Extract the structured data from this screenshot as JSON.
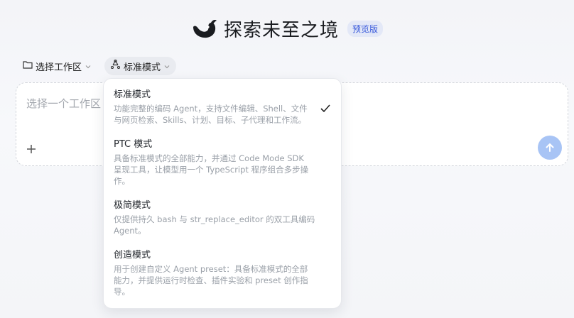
{
  "header": {
    "title": "探索未至之境",
    "badge": "预览版"
  },
  "toolbar": {
    "workspace_label": "选择工作区",
    "mode_label": "标准模式"
  },
  "input": {
    "placeholder": "选择一个工作区"
  },
  "dropdown": {
    "options": [
      {
        "title": "标准模式",
        "desc_line1": "功能完整的编码 Agent，支持文件编辑、Shell、文件",
        "desc_line2": "与网页检索、Skills、计划、目标、子代理和工作流。",
        "desc_line3": "",
        "selected": true
      },
      {
        "title": "PTC 模式",
        "desc_line1": "具备标准模式的全部能力，并通过 Code Mode SDK",
        "desc_line2": "呈现工具，让模型用一个 TypeScript 程序组合多步操",
        "desc_line3": "作。",
        "selected": false
      },
      {
        "title": "极简模式",
        "desc_line1": "仅提供持久 bash 与 str_replace_editor 的双工具编码",
        "desc_line2": "Agent。",
        "desc_line3": "",
        "selected": false
      },
      {
        "title": "创造模式",
        "desc_line1": "用于创建自定义 Agent preset：具备标准模式的全部",
        "desc_line2": "能力，并提供运行时检查、插件实验和 preset 创作指",
        "desc_line3": "导。",
        "selected": false
      }
    ]
  }
}
